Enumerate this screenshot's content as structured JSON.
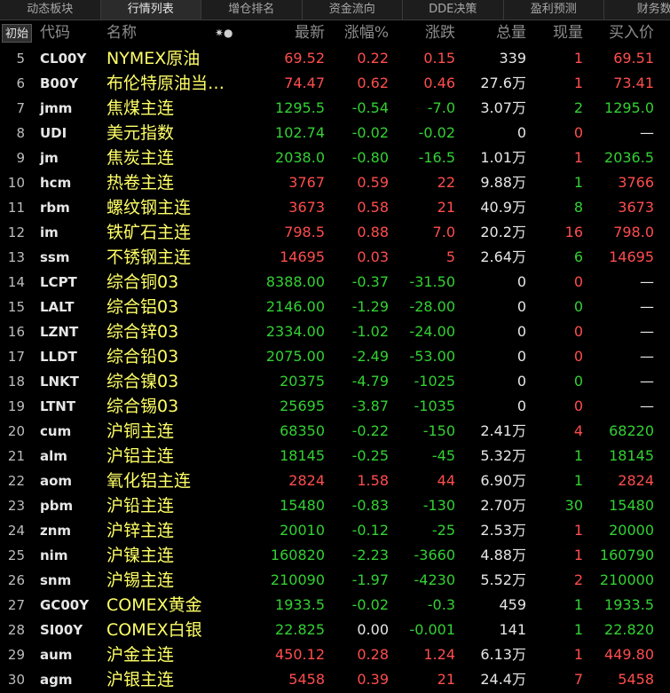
{
  "tabs": [
    "动态板块",
    "行情列表",
    "增仓排名",
    "资金流向",
    "DDE决策",
    "盈利预测",
    "财务数"
  ],
  "active_tab": 1,
  "header": {
    "reset_label": "初始",
    "code": "代码",
    "name": "名称",
    "sort_icon": "✷●",
    "last": "最新",
    "pct": "涨幅%",
    "chg": "涨跌",
    "vol": "总量",
    "cur": "现量",
    "bid": "买入价"
  },
  "colors": {
    "up": "#ff4d4d",
    "down": "#33d133",
    "name": "#ffff66"
  },
  "rows": [
    {
      "idx": "5",
      "code": "CL00Y",
      "name": "NYMEX原油",
      "last": "69.52",
      "pct": "0.22",
      "chg": "0.15",
      "vol": "339",
      "cur": "1",
      "bid": "69.51",
      "dir": "up",
      "cur_dir": "up"
    },
    {
      "idx": "6",
      "code": "B00Y",
      "name": "布伦特原油当…",
      "last": "74.47",
      "pct": "0.62",
      "chg": "0.46",
      "vol": "27.6万",
      "cur": "1",
      "bid": "73.41",
      "dir": "up",
      "cur_dir": "up"
    },
    {
      "idx": "7",
      "code": "jmm",
      "name": "焦煤主连",
      "last": "1295.5",
      "pct": "-0.54",
      "chg": "-7.0",
      "vol": "3.07万",
      "cur": "2",
      "bid": "1295.0",
      "dir": "down",
      "cur_dir": "down"
    },
    {
      "idx": "8",
      "code": "UDI",
      "name": "美元指数",
      "last": "102.74",
      "pct": "-0.02",
      "chg": "-0.02",
      "vol": "0",
      "cur": "0",
      "bid": "—",
      "dir": "down",
      "cur_dir": "up"
    },
    {
      "idx": "9",
      "code": "jm",
      "name": "焦炭主连",
      "last": "2038.0",
      "pct": "-0.80",
      "chg": "-16.5",
      "vol": "1.01万",
      "cur": "1",
      "bid": "2036.5",
      "dir": "down",
      "cur_dir": "up"
    },
    {
      "idx": "10",
      "code": "hcm",
      "name": "热卷主连",
      "last": "3767",
      "pct": "0.59",
      "chg": "22",
      "vol": "9.88万",
      "cur": "1",
      "bid": "3766",
      "dir": "up",
      "cur_dir": "down"
    },
    {
      "idx": "11",
      "code": "rbm",
      "name": "螺纹钢主连",
      "last": "3673",
      "pct": "0.58",
      "chg": "21",
      "vol": "40.9万",
      "cur": "8",
      "bid": "3673",
      "dir": "up",
      "cur_dir": "down"
    },
    {
      "idx": "12",
      "code": "im",
      "name": "铁矿石主连",
      "last": "798.5",
      "pct": "0.88",
      "chg": "7.0",
      "vol": "20.2万",
      "cur": "16",
      "bid": "798.0",
      "dir": "up",
      "cur_dir": "up"
    },
    {
      "idx": "13",
      "code": "ssm",
      "name": "不锈钢主连",
      "last": "14695",
      "pct": "0.03",
      "chg": "5",
      "vol": "2.64万",
      "cur": "6",
      "bid": "14695",
      "dir": "up",
      "cur_dir": "down"
    },
    {
      "idx": "14",
      "code": "LCPT",
      "name": "综合铜03",
      "last": "8388.00",
      "pct": "-0.37",
      "chg": "-31.50",
      "vol": "0",
      "cur": "0",
      "bid": "—",
      "dir": "down",
      "cur_dir": "up"
    },
    {
      "idx": "15",
      "code": "LALT",
      "name": "综合铝03",
      "last": "2146.00",
      "pct": "-1.29",
      "chg": "-28.00",
      "vol": "0",
      "cur": "0",
      "bid": "—",
      "dir": "down",
      "cur_dir": "down"
    },
    {
      "idx": "16",
      "code": "LZNT",
      "name": "综合锌03",
      "last": "2334.00",
      "pct": "-1.02",
      "chg": "-24.00",
      "vol": "0",
      "cur": "0",
      "bid": "—",
      "dir": "down",
      "cur_dir": "up"
    },
    {
      "idx": "17",
      "code": "LLDT",
      "name": "综合铅03",
      "last": "2075.00",
      "pct": "-2.49",
      "chg": "-53.00",
      "vol": "0",
      "cur": "0",
      "bid": "—",
      "dir": "down",
      "cur_dir": "up"
    },
    {
      "idx": "18",
      "code": "LNKT",
      "name": "综合镍03",
      "last": "20375",
      "pct": "-4.79",
      "chg": "-1025",
      "vol": "0",
      "cur": "0",
      "bid": "—",
      "dir": "down",
      "cur_dir": "down"
    },
    {
      "idx": "19",
      "code": "LTNT",
      "name": "综合锡03",
      "last": "25695",
      "pct": "-3.87",
      "chg": "-1035",
      "vol": "0",
      "cur": "0",
      "bid": "—",
      "dir": "down",
      "cur_dir": "up"
    },
    {
      "idx": "20",
      "code": "cum",
      "name": "沪铜主连",
      "last": "68350",
      "pct": "-0.22",
      "chg": "-150",
      "vol": "2.41万",
      "cur": "4",
      "bid": "68220",
      "dir": "down",
      "cur_dir": "up"
    },
    {
      "idx": "21",
      "code": "alm",
      "name": "沪铝主连",
      "last": "18145",
      "pct": "-0.25",
      "chg": "-45",
      "vol": "5.32万",
      "cur": "1",
      "bid": "18145",
      "dir": "down",
      "cur_dir": "down"
    },
    {
      "idx": "22",
      "code": "aom",
      "name": "氧化铝主连",
      "last": "2824",
      "pct": "1.58",
      "chg": "44",
      "vol": "6.90万",
      "cur": "1",
      "bid": "2824",
      "dir": "up",
      "cur_dir": "down"
    },
    {
      "idx": "23",
      "code": "pbm",
      "name": "沪铅主连",
      "last": "15480",
      "pct": "-0.83",
      "chg": "-130",
      "vol": "2.70万",
      "cur": "30",
      "bid": "15480",
      "dir": "down",
      "cur_dir": "down"
    },
    {
      "idx": "24",
      "code": "znm",
      "name": "沪锌主连",
      "last": "20010",
      "pct": "-0.12",
      "chg": "-25",
      "vol": "2.53万",
      "cur": "1",
      "bid": "20000",
      "dir": "down",
      "cur_dir": "up"
    },
    {
      "idx": "25",
      "code": "nim",
      "name": "沪镍主连",
      "last": "160820",
      "pct": "-2.23",
      "chg": "-3660",
      "vol": "4.88万",
      "cur": "1",
      "bid": "160790",
      "dir": "down",
      "cur_dir": "up"
    },
    {
      "idx": "26",
      "code": "snm",
      "name": "沪锡主连",
      "last": "210090",
      "pct": "-1.97",
      "chg": "-4230",
      "vol": "5.52万",
      "cur": "2",
      "bid": "210000",
      "dir": "down",
      "cur_dir": "up"
    },
    {
      "idx": "27",
      "code": "GC00Y",
      "name": "COMEX黄金",
      "last": "1933.5",
      "pct": "-0.02",
      "chg": "-0.3",
      "vol": "459",
      "cur": "1",
      "bid": "1933.5",
      "dir": "down",
      "cur_dir": "down"
    },
    {
      "idx": "28",
      "code": "SI00Y",
      "name": "COMEX白银",
      "last": "22.825",
      "pct": "0.00",
      "chg": "-0.001",
      "vol": "141",
      "cur": "1",
      "bid": "22.820",
      "dir": "down",
      "pct_dir": "flat",
      "cur_dir": "down"
    },
    {
      "idx": "29",
      "code": "aum",
      "name": "沪金主连",
      "last": "450.12",
      "pct": "0.28",
      "chg": "1.24",
      "vol": "6.13万",
      "cur": "1",
      "bid": "449.80",
      "dir": "up",
      "cur_dir": "up"
    },
    {
      "idx": "30",
      "code": "agm",
      "name": "沪银主连",
      "last": "5458",
      "pct": "0.39",
      "chg": "21",
      "vol": "24.4万",
      "cur": "7",
      "bid": "5458",
      "dir": "up",
      "cur_dir": "up"
    }
  ]
}
